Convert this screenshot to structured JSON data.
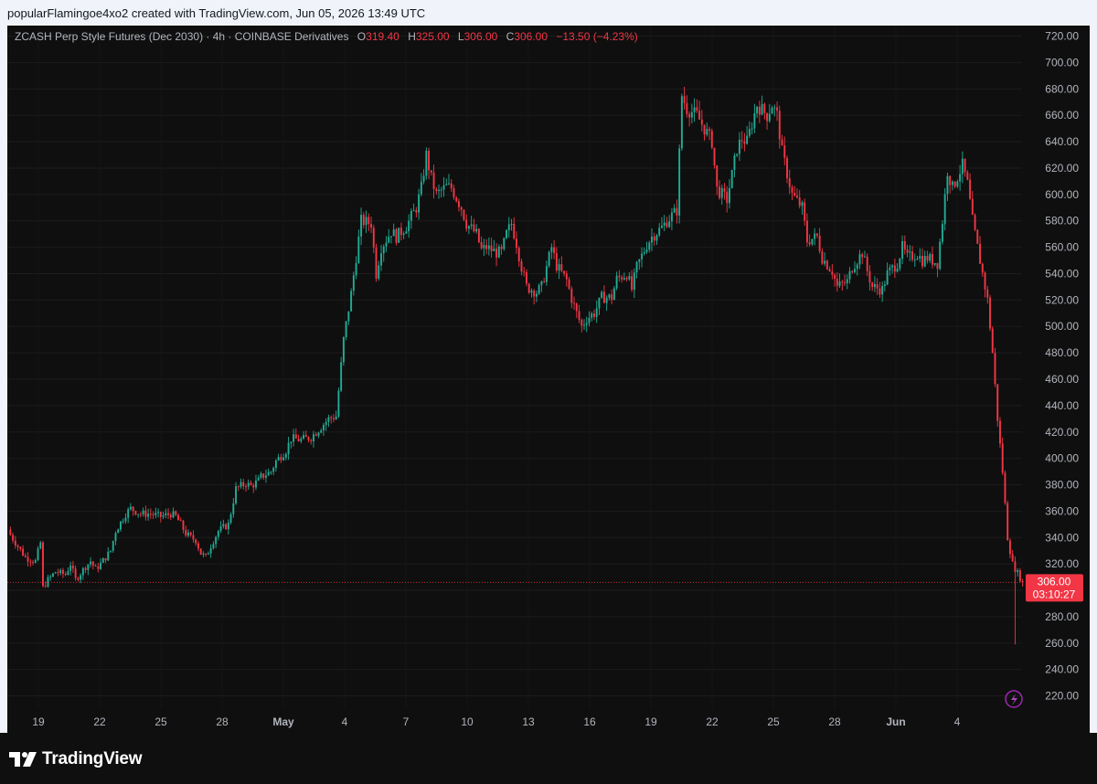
{
  "caption": "popularFlamingoe4xo2 created with TradingView.com, Jun 05, 2026 13:49 UTC",
  "header": {
    "title": "ZCASH Perp Style Futures (Dec 2030) · 4h · COINBASE Derivatives",
    "o_label": "O",
    "o_value": "319.40",
    "h_label": "H",
    "h_value": "325.00",
    "l_label": "L",
    "l_value": "306.00",
    "c_label": "C",
    "c_value": "306.00",
    "change": "−13.50 (−4.23%)"
  },
  "price_tag": {
    "price": "306.00",
    "countdown": "03:10:27"
  },
  "brand": {
    "name": "TradingView",
    "icon": "tradingview-logo-icon"
  },
  "colors": {
    "up": "#22ab94",
    "down": "#f23645",
    "background": "#0f0f0f",
    "axis_text": "#b2b5be"
  },
  "chart_data": {
    "type": "candlestick",
    "interval": "4h",
    "ylim": [
      210,
      728
    ],
    "y_ticks": [
      "220.00",
      "240.00",
      "260.00",
      "280.00",
      "300.00",
      "320.00",
      "340.00",
      "360.00",
      "380.00",
      "400.00",
      "420.00",
      "440.00",
      "460.00",
      "480.00",
      "500.00",
      "520.00",
      "540.00",
      "560.00",
      "580.00",
      "600.00",
      "620.00",
      "640.00",
      "660.00",
      "680.00",
      "700.00",
      "720.00"
    ],
    "x_ticks": [
      "19",
      "22",
      "25",
      "28",
      "May",
      "4",
      "7",
      "10",
      "13",
      "16",
      "19",
      "22",
      "25",
      "28",
      "Jun",
      "4"
    ],
    "bold_x_ticks": [
      "May",
      "Jun"
    ],
    "last_price": 306.0,
    "close_path": [
      [
        0,
        342
      ],
      [
        6,
        325
      ],
      [
        10,
        322
      ],
      [
        12,
        336
      ],
      [
        13,
        302
      ],
      [
        15,
        308
      ],
      [
        18,
        314
      ],
      [
        22,
        312
      ],
      [
        24,
        320
      ],
      [
        26,
        308
      ],
      [
        30,
        318
      ],
      [
        32,
        322
      ],
      [
        34,
        316
      ],
      [
        36,
        320
      ],
      [
        40,
        330
      ],
      [
        42,
        345
      ],
      [
        46,
        358
      ],
      [
        48,
        362
      ],
      [
        52,
        358
      ],
      [
        56,
        358
      ],
      [
        60,
        356
      ],
      [
        64,
        358
      ],
      [
        66,
        356
      ],
      [
        68,
        350
      ],
      [
        70,
        343
      ],
      [
        72,
        340
      ],
      [
        74,
        338
      ],
      [
        76,
        328
      ],
      [
        78,
        325
      ],
      [
        80,
        334
      ],
      [
        83,
        345
      ],
      [
        87,
        350
      ],
      [
        90,
        377
      ],
      [
        94,
        381
      ],
      [
        96,
        379
      ],
      [
        99,
        383
      ],
      [
        100,
        386
      ],
      [
        104,
        390
      ],
      [
        106,
        398
      ],
      [
        110,
        406
      ],
      [
        112,
        415
      ],
      [
        116,
        414
      ],
      [
        120,
        416
      ],
      [
        124,
        424
      ],
      [
        127,
        430
      ],
      [
        130,
        432
      ],
      [
        133,
        490
      ],
      [
        136,
        525
      ],
      [
        140,
        580
      ],
      [
        144,
        578
      ],
      [
        146,
        540
      ],
      [
        148,
        560
      ],
      [
        152,
        572
      ],
      [
        154,
        568
      ],
      [
        158,
        576
      ],
      [
        162,
        590
      ],
      [
        164,
        605
      ],
      [
        166,
        630
      ],
      [
        168,
        612
      ],
      [
        170,
        600
      ],
      [
        174,
        606
      ],
      [
        176,
        605
      ],
      [
        180,
        590
      ],
      [
        182,
        578
      ],
      [
        186,
        570
      ],
      [
        188,
        558
      ],
      [
        190,
        560
      ],
      [
        194,
        556
      ],
      [
        196,
        556
      ],
      [
        198,
        570
      ],
      [
        200,
        578
      ],
      [
        202,
        563
      ],
      [
        204,
        545
      ],
      [
        206,
        530
      ],
      [
        210,
        526
      ],
      [
        212,
        530
      ],
      [
        214,
        545
      ],
      [
        216,
        560
      ],
      [
        218,
        546
      ],
      [
        222,
        535
      ],
      [
        224,
        521
      ],
      [
        226,
        510
      ],
      [
        228,
        500
      ],
      [
        230,
        506
      ],
      [
        233,
        510
      ],
      [
        236,
        522
      ],
      [
        240,
        522
      ],
      [
        242,
        536
      ],
      [
        246,
        540
      ],
      [
        248,
        528
      ],
      [
        250,
        545
      ],
      [
        254,
        562
      ],
      [
        256,
        568
      ],
      [
        260,
        575
      ],
      [
        262,
        580
      ],
      [
        266,
        588
      ],
      [
        268,
        675
      ],
      [
        270,
        665
      ],
      [
        274,
        660
      ],
      [
        277,
        650
      ],
      [
        280,
        640
      ],
      [
        282,
        604
      ],
      [
        286,
        596
      ],
      [
        288,
        615
      ],
      [
        290,
        635
      ],
      [
        292,
        642
      ],
      [
        294,
        640
      ],
      [
        298,
        668
      ],
      [
        302,
        660
      ],
      [
        304,
        668
      ],
      [
        306,
        660
      ],
      [
        308,
        632
      ],
      [
        312,
        600
      ],
      [
        316,
        590
      ],
      [
        318,
        565
      ],
      [
        322,
        568
      ],
      [
        324,
        552
      ],
      [
        328,
        542
      ],
      [
        330,
        530
      ],
      [
        334,
        534
      ],
      [
        336,
        545
      ],
      [
        340,
        556
      ],
      [
        342,
        542
      ],
      [
        344,
        530
      ],
      [
        348,
        528
      ],
      [
        350,
        540
      ],
      [
        354,
        548
      ],
      [
        356,
        560
      ],
      [
        358,
        552
      ],
      [
        362,
        555
      ],
      [
        364,
        550
      ],
      [
        366,
        552
      ],
      [
        370,
        548
      ],
      [
        372,
        580
      ],
      [
        374,
        618
      ],
      [
        376,
        605
      ],
      [
        380,
        622
      ],
      [
        382,
        608
      ],
      [
        384,
        580
      ],
      [
        386,
        560
      ],
      [
        388,
        540
      ],
      [
        390,
        520
      ],
      [
        392,
        480
      ],
      [
        394,
        430
      ],
      [
        396,
        390
      ],
      [
        398,
        340
      ],
      [
        400,
        320
      ],
      [
        402,
        313
      ],
      [
        404,
        306
      ]
    ]
  }
}
